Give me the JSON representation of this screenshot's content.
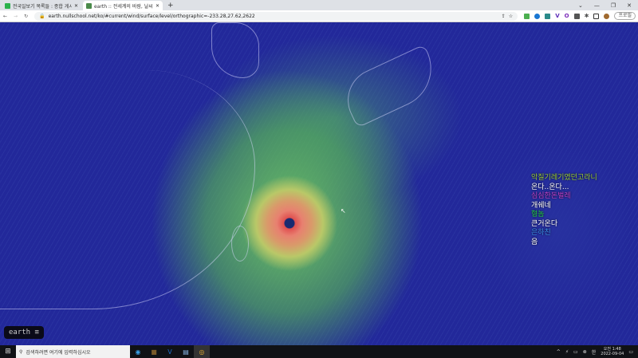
{
  "browser": {
    "tabs": [
      {
        "label": "전국일보기 목록들 : 종합 게시판",
        "active": false
      },
      {
        "label": "earth :: 전세계의 바람, 날씨, 바다",
        "active": true
      }
    ],
    "url": "earth.nullschool.net/ko/#current/wind/surface/level/orthographic=-233.28,27.62,2622",
    "profile_label": "프로필"
  },
  "chat": [
    {
      "name": "악질기레기였던고라니",
      "color": "#9acd32"
    },
    {
      "message": "온다..온다..."
    },
    {
      "name": "심심한돈벌레",
      "color": "#b03ab8"
    },
    {
      "message": "개쉐네"
    },
    {
      "name": "형놈",
      "color": "#22cc44"
    },
    {
      "message": "큰거온다"
    },
    {
      "name": "은하친",
      "color": "#3a8ee8"
    },
    {
      "message": "음"
    }
  ],
  "earth_button": "earth ≡",
  "taskbar": {
    "search_placeholder": "검색하려면 여기에 입력하십시오",
    "time": "오전 1:48",
    "date": "2022-09-04"
  }
}
